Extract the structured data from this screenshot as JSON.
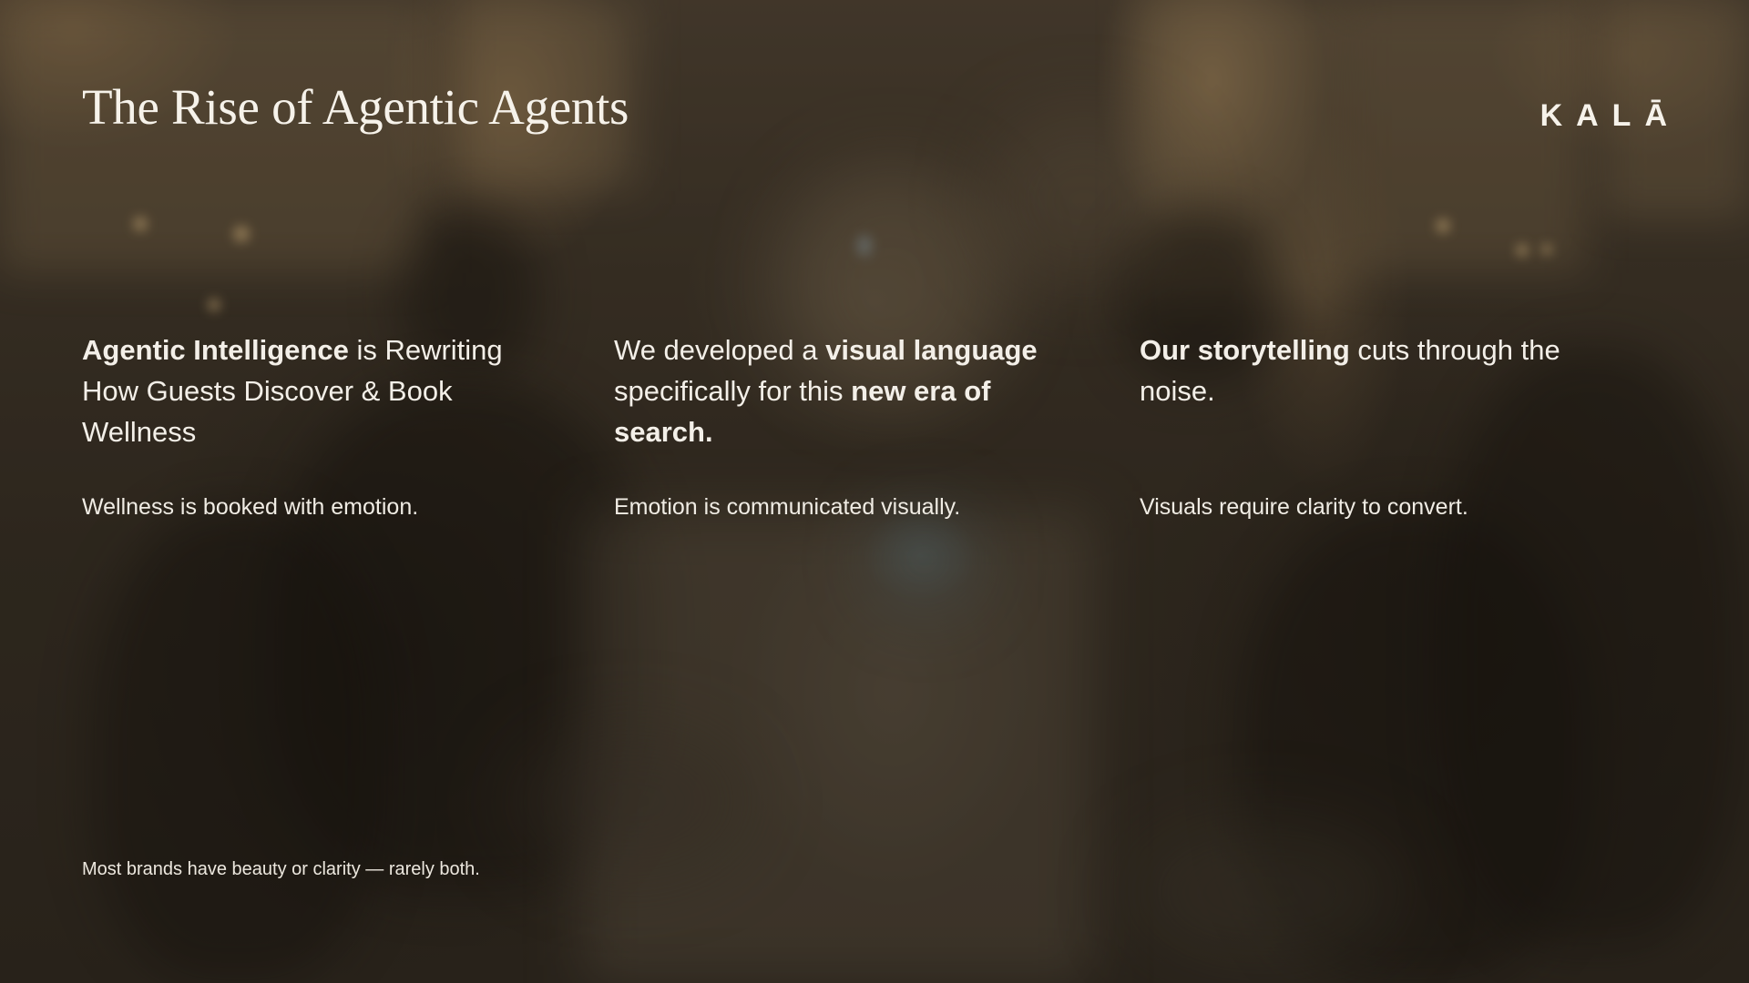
{
  "slide": {
    "title": "The Rise of Agentic Agents",
    "logo_text": "KALĀ",
    "columns": [
      {
        "headline_parts": [
          {
            "text": "Agentic Intelligence",
            "bold": true
          },
          {
            "text": " is Rewriting How Guests Discover & Book Wellness",
            "bold": false
          }
        ],
        "subtext": "Wellness is booked with emotion."
      },
      {
        "headline_parts": [
          {
            "text": "We developed a ",
            "bold": false
          },
          {
            "text": "visual language",
            "bold": true
          },
          {
            "text": " specifically for this ",
            "bold": false
          },
          {
            "text": "new era of search.",
            "bold": true
          }
        ],
        "subtext": "Emotion is communicated visually."
      },
      {
        "headline_parts": [
          {
            "text": "Our storytelling",
            "bold": true
          },
          {
            "text": " cuts through the noise.",
            "bold": false
          }
        ],
        "subtext": "Visuals require clarity to convert."
      }
    ],
    "footer_note": "Most brands have beauty or clarity — rarely both."
  }
}
